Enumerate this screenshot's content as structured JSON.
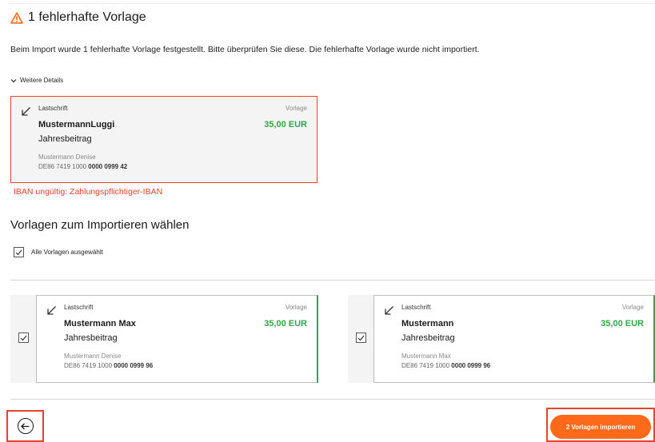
{
  "header": {
    "icon": "warning-triangle-icon",
    "title": "1 fehlerhafte Vorlage",
    "accent_color": "#ff6a1a"
  },
  "intro_text": "Beim Import wurde 1 fehlerhafte Vorlage festgestellt. Bitte überprüfen Sie diese. Die fehlerhafte Vorlage wurde nicht importiert.",
  "details_toggle": {
    "label": "Weitere Details",
    "icon": "chevron-down-icon"
  },
  "faulty_template": {
    "type": "Lastschrift",
    "tag": "Vorlage",
    "name": "MustermannLuggi",
    "amount": "35,00 EUR",
    "purpose": "Jahresbeitrag",
    "holder": "Mustermann Denise",
    "iban_prefix": "DE86 7419 1000",
    "iban_suffix": "0000 0999 42",
    "error": "IBAN ungültig: Zahlungspflichtiger-IBAN",
    "error_color": "#e8412c"
  },
  "selection": {
    "title": "Vorlagen zum Importieren wählen",
    "select_all_label": "Alle Vorlagen ausgewählt",
    "select_all_checked": true
  },
  "templates": [
    {
      "checked": true,
      "type": "Lastschrift",
      "tag": "Vorlage",
      "name": "Mustermann Max",
      "amount": "35,00 EUR",
      "purpose": "Jahresbeitrag",
      "holder": "Mustermann Denise",
      "iban_prefix": "DE86 7419 1000",
      "iban_suffix": "0000 0999 96"
    },
    {
      "checked": true,
      "type": "Lastschrift",
      "tag": "Vorlage",
      "name": "Mustermann",
      "amount": "35,00 EUR",
      "purpose": "Jahresbeitrag",
      "holder": "Mustermann Max",
      "iban_prefix": "DE86 7419 1000",
      "iban_suffix": "0000 0999 96"
    }
  ],
  "footer": {
    "back_icon": "arrow-left-circle-icon",
    "import_label": "2 Vorlagen importieren",
    "amount_color": "#2ea84a"
  }
}
